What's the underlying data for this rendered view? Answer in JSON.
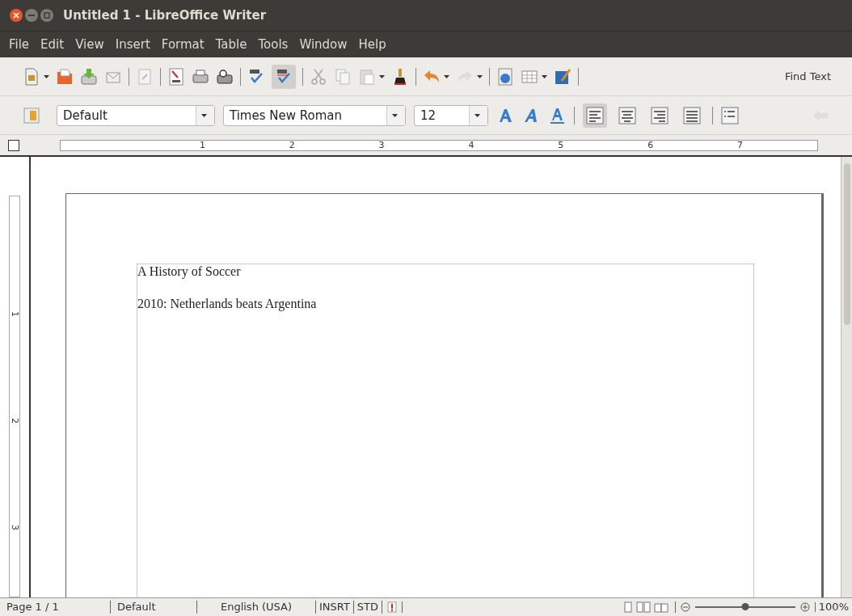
{
  "window": {
    "title": "Untitled 1 - LibreOffice Writer"
  },
  "menu": [
    "File",
    "Edit",
    "View",
    "Insert",
    "Format",
    "Table",
    "Tools",
    "Window",
    "Help"
  ],
  "standard_toolbar": {
    "auto_spellcheck": {
      "pressed": true
    },
    "find_text": "Find Text"
  },
  "formatting_toolbar": {
    "paragraph_style": "Default",
    "font_name": "Times New Roman",
    "font_size": "12",
    "alignment": [
      {
        "kind": "left",
        "selected": true
      },
      {
        "kind": "center",
        "selected": false
      },
      {
        "kind": "right",
        "selected": false
      },
      {
        "kind": "justify",
        "selected": false
      }
    ]
  },
  "ruler": {
    "labels": [
      "1",
      "2",
      "3",
      "4",
      "5",
      "6",
      "7"
    ]
  },
  "vertical_ruler": {
    "labels": [
      "1",
      "2",
      "3"
    ]
  },
  "document": {
    "paragraphs": [
      "A History of Soccer",
      "2010: Netherlands beats Argentina"
    ]
  },
  "status_bar": {
    "page": "Page 1 / 1",
    "page_style": "Default",
    "language": "English (USA)",
    "insert_mode": "INSRT",
    "selection_mode": "STD",
    "zoom_slider": {
      "level": 0.5
    },
    "zoom": "100%"
  }
}
